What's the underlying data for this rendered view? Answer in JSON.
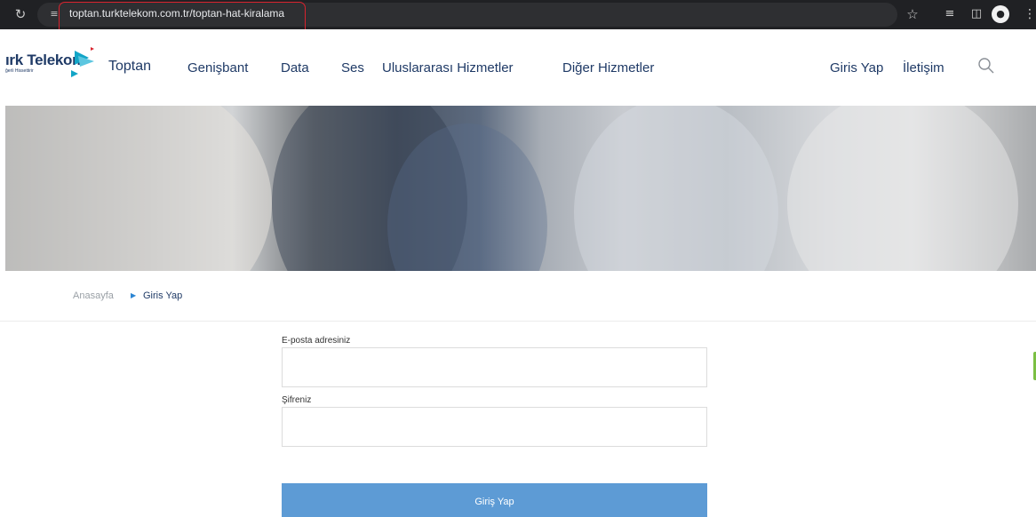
{
  "browser": {
    "url": "toptan.turktelekom.com.tr/toptan-hat-kiralama",
    "icons": [
      "reload-icon",
      "site-info-icon",
      "bookmark-star-icon",
      "reading-list-icon",
      "side-panel-icon",
      "profile-icon",
      "menu-icon"
    ]
  },
  "header": {
    "logo_text": "ırk Telekom",
    "logo_sub": "ğerli Hissettirir",
    "logo_toptan": "Toptan",
    "nav": {
      "genisbant": "Genişbant",
      "data": "Data",
      "ses": "Ses",
      "uluslararasi": "Uluslararası Hizmetler",
      "diger": "Diğer Hizmetler",
      "giris": "Giris Yap",
      "iletisim": "İletişim"
    }
  },
  "breadcrumb": {
    "home": "Anasayfa",
    "current": "Giris Yap"
  },
  "form": {
    "email_label": "E-posta adresiniz",
    "email_value": "",
    "password_label": "Şifreniz",
    "password_value": "",
    "submit_label": "Giriş Yap"
  },
  "colors": {
    "brand_navy": "#1f3a66",
    "accent_blue": "#5d9bd5",
    "logo_cyan": "#12a5c7",
    "highlight_red": "#d9232e",
    "side_tab_green": "#7bc043"
  }
}
